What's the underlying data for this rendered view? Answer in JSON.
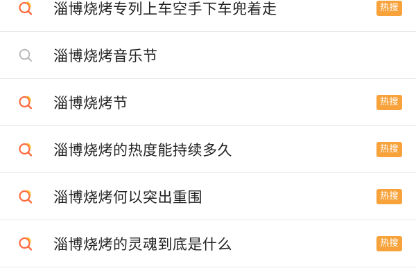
{
  "colors": {
    "hot_badge": "#f7a23b",
    "hot_icon_ring": "#ff6a3d",
    "hot_icon_spark": "#ffb82e",
    "plain_icon": "#b5b5b5"
  },
  "suggestions": [
    {
      "text": "淄博烧烤专列上车空手下车兜着走",
      "badge": "热搜",
      "icon": "hot-search-icon"
    },
    {
      "text": "淄博烧烤音乐节",
      "badge": "",
      "icon": "search-icon"
    },
    {
      "text": "淄博烧烤节",
      "badge": "热搜",
      "icon": "hot-search-icon"
    },
    {
      "text": "淄博烧烤的热度能持续多久",
      "badge": "热搜",
      "icon": "hot-search-icon"
    },
    {
      "text": "淄博烧烤何以突出重围",
      "badge": "热搜",
      "icon": "hot-search-icon"
    },
    {
      "text": "淄博烧烤的灵魂到底是什么",
      "badge": "热搜",
      "icon": "hot-search-icon"
    }
  ]
}
